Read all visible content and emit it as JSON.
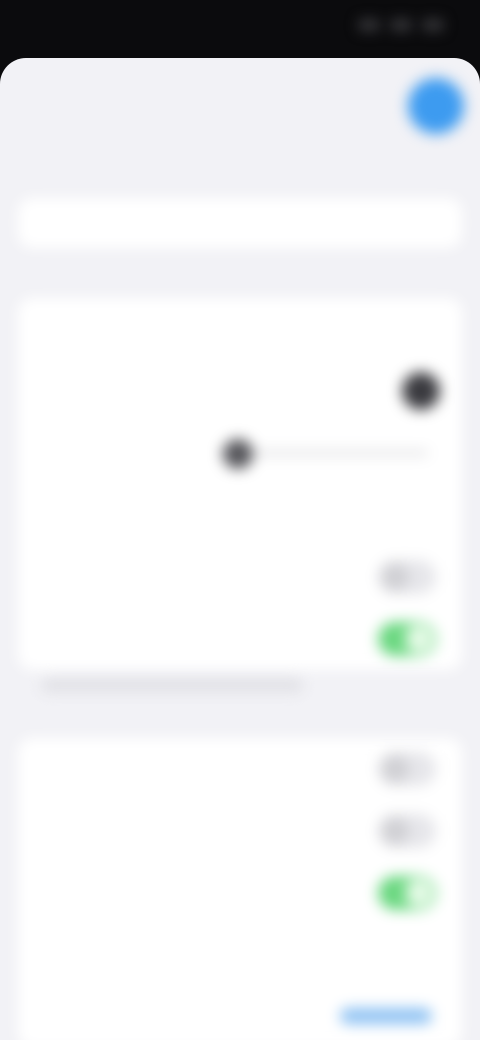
{
  "status_bar": {
    "time": "",
    "icons": [
      "cellular-icon",
      "wifi-icon",
      "battery-icon"
    ]
  },
  "nav": {
    "title": "",
    "action_icon": "circle-action-icon",
    "accent_color": "#3d9bf0"
  },
  "name_field": {
    "placeholder": ""
  },
  "section1": {
    "header": "",
    "rows": [
      {
        "label": "",
        "control": "none"
      },
      {
        "label": "",
        "control": "color-dot"
      },
      {
        "label": "",
        "control": "slider",
        "value": 0.05
      },
      {
        "label": "",
        "control": "none"
      },
      {
        "label": "",
        "control": "toggle",
        "on": false
      },
      {
        "label": "",
        "control": "toggle",
        "on": true
      }
    ],
    "footer": ""
  },
  "section2": {
    "header": "",
    "rows": [
      {
        "label": "",
        "control": "toggle",
        "on": false
      },
      {
        "label": "",
        "control": "toggle",
        "on": false
      },
      {
        "label": "",
        "control": "toggle",
        "on": true
      },
      {
        "label": "",
        "control": "none"
      },
      {
        "label": "",
        "control": "value-link"
      }
    ]
  },
  "colors": {
    "toggle_on": "#69d77f",
    "toggle_off": "#e6e6ea",
    "link": "#8ec2f3",
    "background": "#f2f2f6"
  }
}
